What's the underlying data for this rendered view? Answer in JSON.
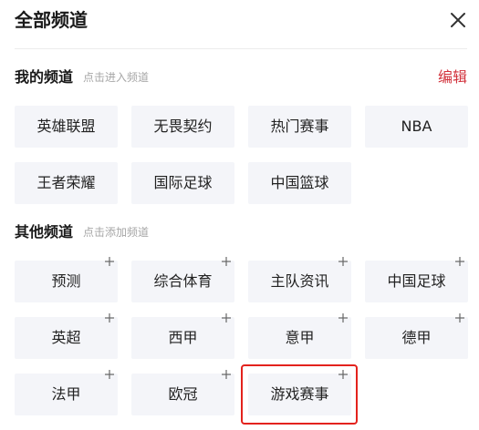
{
  "header": {
    "title": "全部频道"
  },
  "my_channels": {
    "title": "我的频道",
    "hint": "点击进入频道",
    "edit_label": "编辑",
    "items": [
      {
        "label": "英雄联盟"
      },
      {
        "label": "无畏契约"
      },
      {
        "label": "热门赛事"
      },
      {
        "label": "NBA"
      },
      {
        "label": "王者荣耀"
      },
      {
        "label": "国际足球"
      },
      {
        "label": "中国篮球"
      }
    ]
  },
  "other_channels": {
    "title": "其他频道",
    "hint": "点击添加频道",
    "items": [
      {
        "label": "预测"
      },
      {
        "label": "综合体育"
      },
      {
        "label": "主队资讯"
      },
      {
        "label": "中国足球"
      },
      {
        "label": "英超"
      },
      {
        "label": "西甲"
      },
      {
        "label": "意甲"
      },
      {
        "label": "德甲"
      },
      {
        "label": "法甲"
      },
      {
        "label": "欧冠"
      },
      {
        "label": "游戏赛事"
      }
    ]
  },
  "colors": {
    "accent": "#d2323c",
    "chip_background": "#f4f5f9",
    "highlight": "#e3221d"
  }
}
